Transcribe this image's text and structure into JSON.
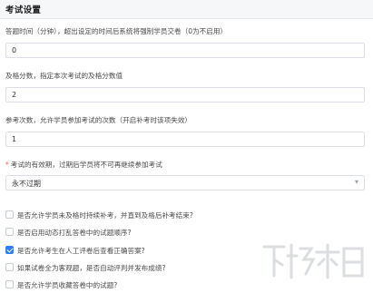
{
  "section": {
    "title": "考试设置"
  },
  "fields": [
    {
      "label": "答题时间（分钟），超出设定的时间后系统将强制学员交卷（0为不启用）",
      "value": "0"
    },
    {
      "label": "及格分数，指定本次考试的及格分数值",
      "value": "2"
    },
    {
      "label": "参考次数，允许学员参加考试的次数（开启补考时该项失效）",
      "value": "1"
    }
  ],
  "validity": {
    "required_mark": "*",
    "label": "考试的有效期，过期后学员将不可再继续参加考试",
    "selected": "永不过期",
    "arrow_icon": "chevron-down-icon"
  },
  "options": [
    {
      "label": "是否允许学员未及格时持续补考，并直到及格后补考结束?",
      "checked": false
    },
    {
      "label": "是否启用动态打乱答卷中的试题顺序?",
      "checked": false
    },
    {
      "label": "是否允许考生在人工评卷后查看正确答案?",
      "checked": true
    },
    {
      "label": "如果试卷全为客观题，是否自动评判并发布成绩?",
      "checked": false
    },
    {
      "label": "是否允许学员收藏答卷中的试题?",
      "checked": false
    }
  ],
  "colors": {
    "accent": "#2d7ff9",
    "required": "#f05a4f"
  }
}
